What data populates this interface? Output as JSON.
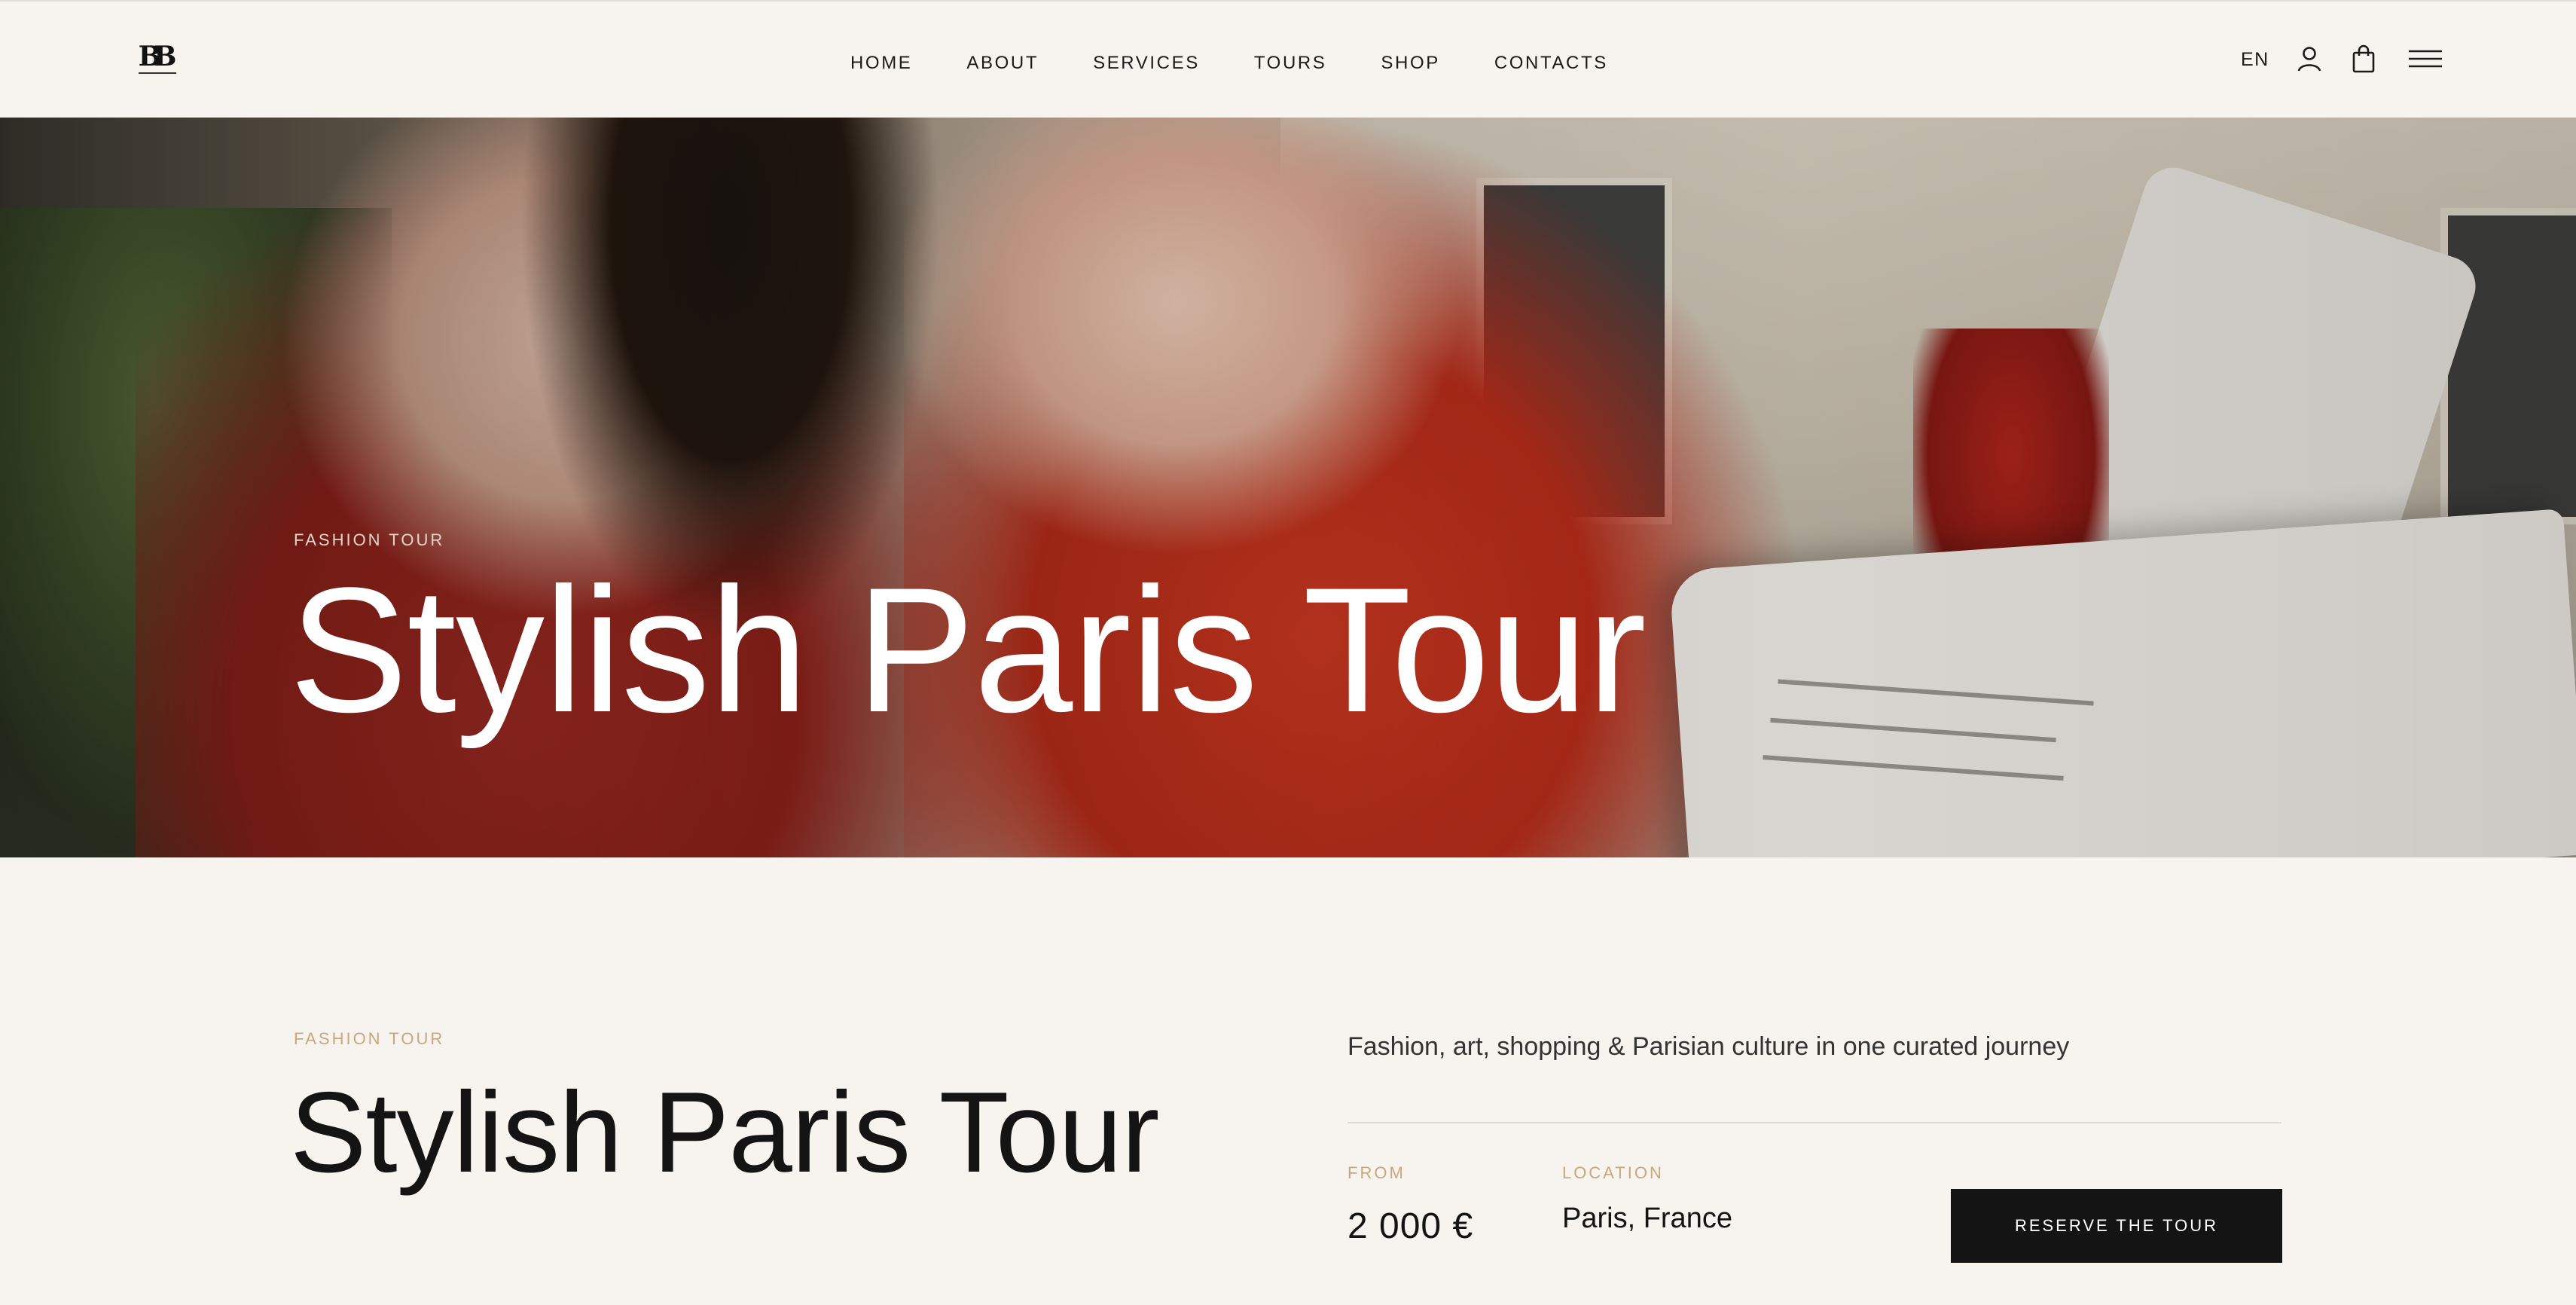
{
  "header": {
    "logo_text": "BB",
    "nav": [
      {
        "label": "HOME"
      },
      {
        "label": "ABOUT"
      },
      {
        "label": "SERVICES"
      },
      {
        "label": "TOURS"
      },
      {
        "label": "SHOP"
      },
      {
        "label": "CONTACTS"
      }
    ],
    "language": "EN",
    "icons": [
      "account-icon",
      "cart-icon",
      "menu-icon"
    ]
  },
  "hero": {
    "eyebrow": "FASHION TOUR",
    "title": "Stylish Paris Tour"
  },
  "details": {
    "eyebrow": "FASHION TOUR",
    "title": "Stylish Paris Tour",
    "tagline": "Fashion, art, shopping & Parisian culture in one curated journey",
    "from_label": "FROM",
    "price": "2 000 €",
    "location_label": "LOCATION",
    "location": "Paris, France",
    "reserve_label": "RESERVE THE TOUR"
  },
  "colors": {
    "background": "#f7f4ef",
    "accent": "#c9a77d",
    "button": "#141414"
  }
}
